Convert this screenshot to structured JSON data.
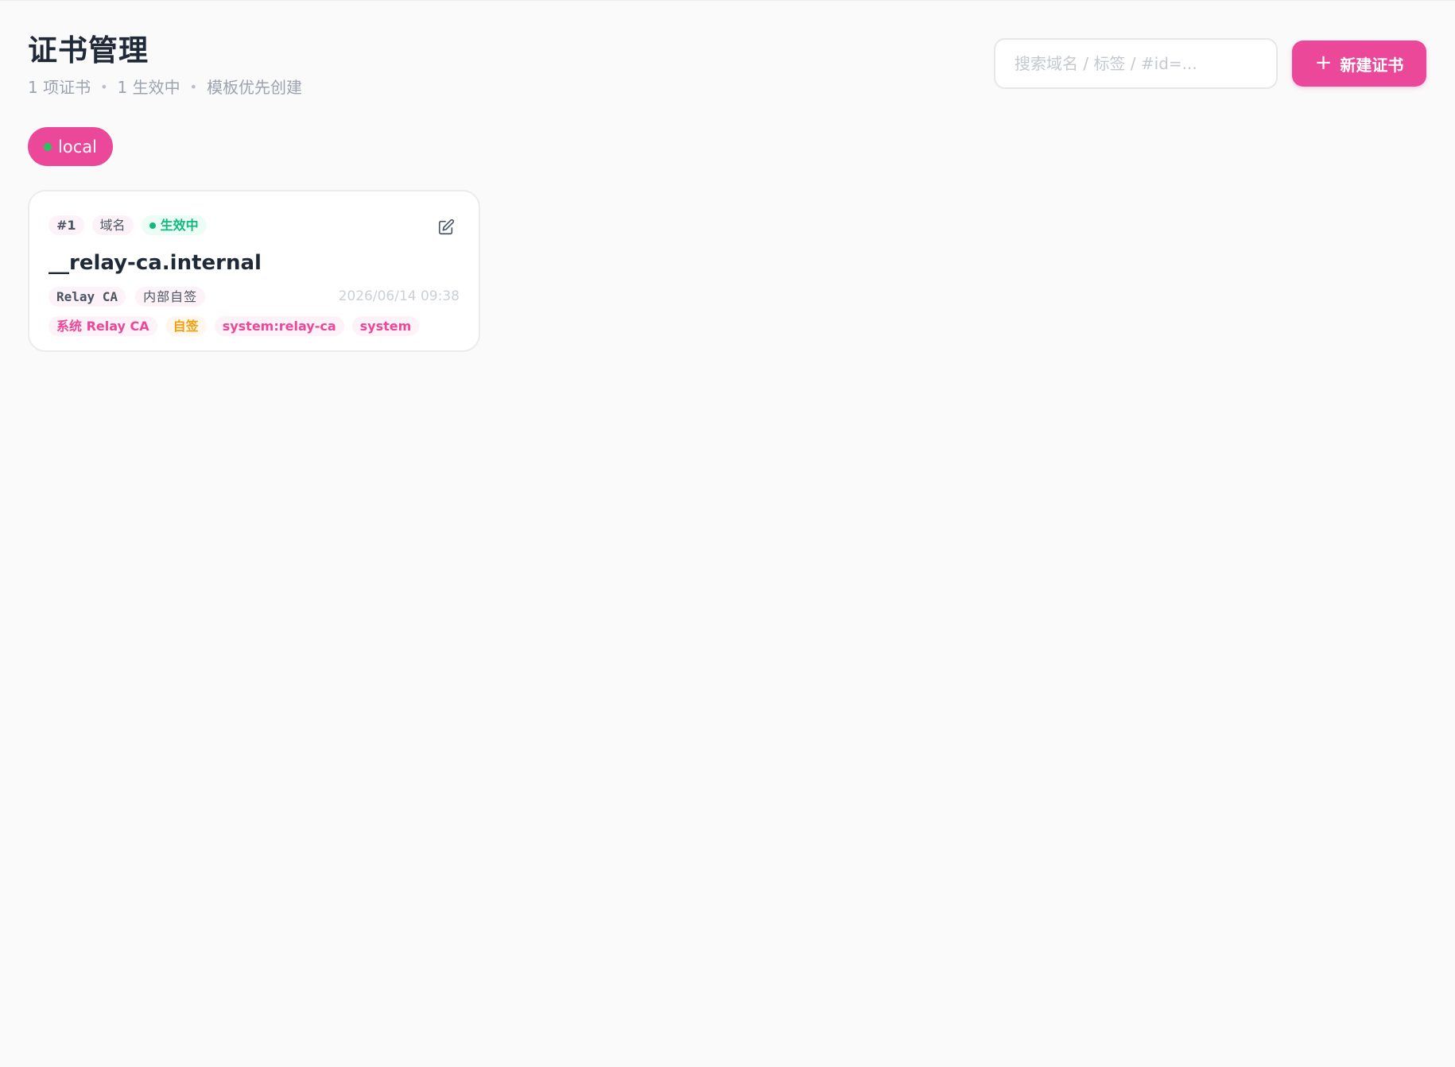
{
  "header": {
    "title": "证书管理",
    "stats": {
      "count": "1 项证书",
      "active": "1 生效中",
      "note": "模板优先创建"
    },
    "separator": "•"
  },
  "search": {
    "placeholder": "搜索域名 / 标签 / #id=...",
    "value": ""
  },
  "new_button": {
    "icon": "+",
    "label": "新建证书"
  },
  "env_pill": {
    "label": "local",
    "dot_color": "#22c55e"
  },
  "colors": {
    "accent": "#ec4899",
    "success": "#10b981",
    "warning": "#f59e0b"
  },
  "cards": [
    {
      "id": "#1",
      "type": "域名",
      "status": "生效中",
      "domain": "__relay-ca.internal",
      "issuer": "Relay CA",
      "issuer_kind": "内部自签",
      "updated": "2026/06/14 09:38",
      "tags": [
        {
          "label": "系统 Relay CA",
          "tone": "pink"
        },
        {
          "label": "自签",
          "tone": "orange"
        },
        {
          "label": "system:relay-ca",
          "tone": "pink"
        },
        {
          "label": "system",
          "tone": "pink"
        }
      ]
    }
  ]
}
